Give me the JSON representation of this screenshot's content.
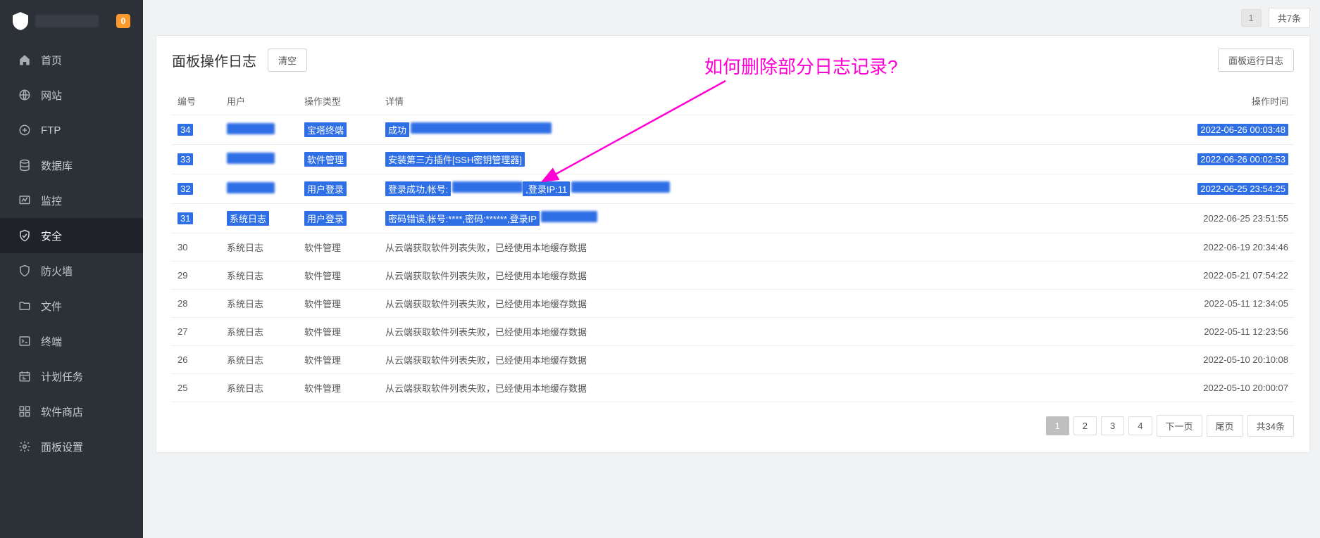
{
  "brand": {
    "badge": "0"
  },
  "sidebar": {
    "items": [
      {
        "label": "首页",
        "icon": "home-icon"
      },
      {
        "label": "网站",
        "icon": "globe-icon"
      },
      {
        "label": "FTP",
        "icon": "ftp-icon"
      },
      {
        "label": "数据库",
        "icon": "database-icon"
      },
      {
        "label": "监控",
        "icon": "monitor-icon"
      },
      {
        "label": "安全",
        "icon": "shield-icon",
        "active": true
      },
      {
        "label": "防火墙",
        "icon": "firewall-icon"
      },
      {
        "label": "文件",
        "icon": "folder-icon"
      },
      {
        "label": "终端",
        "icon": "terminal-icon"
      },
      {
        "label": "计划任务",
        "icon": "cron-icon"
      },
      {
        "label": "软件商店",
        "icon": "appstore-icon"
      },
      {
        "label": "面板设置",
        "icon": "settings-icon"
      }
    ]
  },
  "topbar": {
    "page": "1",
    "total_label": "共7条"
  },
  "panel": {
    "title": "面板操作日志",
    "clear_btn": "清空",
    "runlog_btn": "面板运行日志"
  },
  "annotation": {
    "text": "如何删除部分日志记录?"
  },
  "table": {
    "headers": {
      "id": "编号",
      "user": "用户",
      "op": "操作类型",
      "detail": "详情",
      "time": "操作时间"
    },
    "rows": [
      {
        "id": "34",
        "user_blur": true,
        "op": "宝塔终端",
        "detail_prefix": "成功",
        "detail_blur": true,
        "time": "2022-06-26 00:03:48",
        "selected": true
      },
      {
        "id": "33",
        "user_blur": true,
        "op": "软件管理",
        "detail": "安装第三方插件[SSH密钥管理器]",
        "time": "2022-06-26 00:02:53",
        "selected": true
      },
      {
        "id": "32",
        "user_blur": true,
        "op": "用户登录",
        "detail_prefix": "登录成功,帐号:",
        "detail_mid_blur": true,
        "detail_suffix": ",登录IP:11",
        "time": "2022-06-25 23:54:25",
        "selected": true
      },
      {
        "id": "31",
        "user": "系统日志",
        "op": "用户登录",
        "detail_prefix": "密码错误,帐号:****,密码:******,登录IP",
        "detail_blur_tail": true,
        "time": "2022-06-25 23:51:55",
        "selected_partial": true
      },
      {
        "id": "30",
        "user": "系统日志",
        "op": "软件管理",
        "detail": "从云端获取软件列表失败，已经使用本地缓存数据",
        "time": "2022-06-19 20:34:46"
      },
      {
        "id": "29",
        "user": "系统日志",
        "op": "软件管理",
        "detail": "从云端获取软件列表失败，已经使用本地缓存数据",
        "time": "2022-05-21 07:54:22"
      },
      {
        "id": "28",
        "user": "系统日志",
        "op": "软件管理",
        "detail": "从云端获取软件列表失败，已经使用本地缓存数据",
        "time": "2022-05-11 12:34:05"
      },
      {
        "id": "27",
        "user": "系统日志",
        "op": "软件管理",
        "detail": "从云端获取软件列表失败，已经使用本地缓存数据",
        "time": "2022-05-11 12:23:56"
      },
      {
        "id": "26",
        "user": "系统日志",
        "op": "软件管理",
        "detail": "从云端获取软件列表失败，已经使用本地缓存数据",
        "time": "2022-05-10 20:10:08"
      },
      {
        "id": "25",
        "user": "系统日志",
        "op": "软件管理",
        "detail": "从云端获取软件列表失败，已经使用本地缓存数据",
        "time": "2022-05-10 20:00:07"
      }
    ]
  },
  "pager": {
    "pages": [
      "1",
      "2",
      "3",
      "4"
    ],
    "next": "下一页",
    "last": "尾页",
    "total": "共34条"
  }
}
